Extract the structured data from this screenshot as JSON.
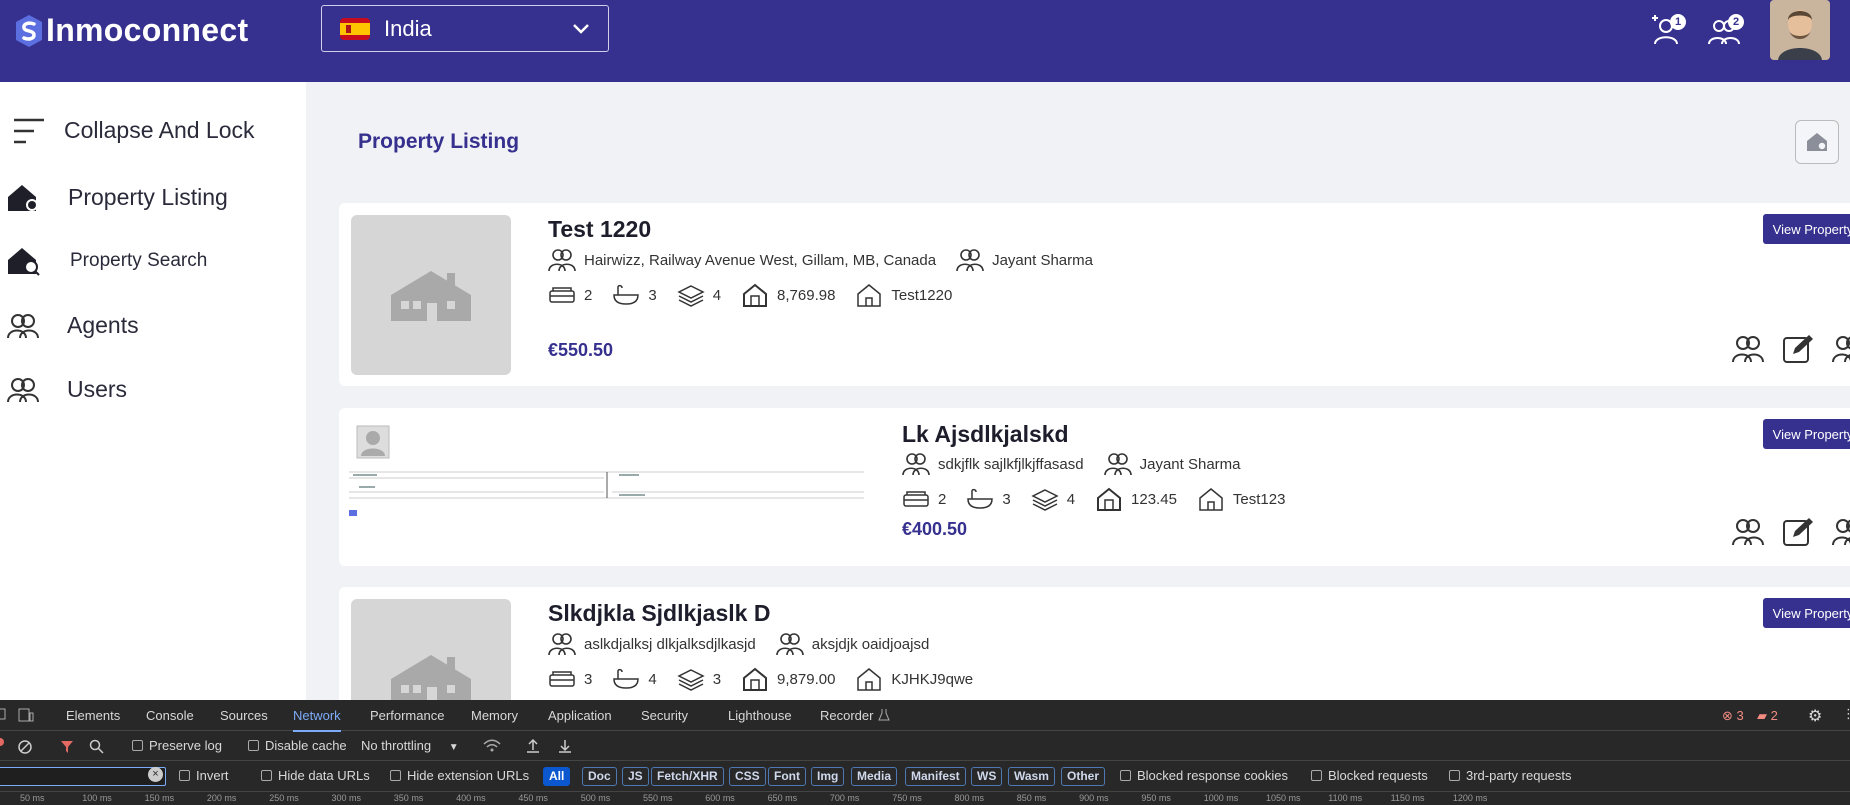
{
  "header": {
    "brand": "Inmoconnect",
    "country": "India",
    "badge_1": "1",
    "badge_2": "2"
  },
  "sidebar": {
    "items": [
      {
        "label": "Collapse And Lock",
        "icon": "menu-icon"
      },
      {
        "label": "Property Listing",
        "icon": "house-gear-icon"
      },
      {
        "label": "Property Search",
        "icon": "house-search-icon"
      },
      {
        "label": "Agents",
        "icon": "users-icon"
      },
      {
        "label": "Users",
        "icon": "users-icon"
      }
    ]
  },
  "main": {
    "title": "Property Listing",
    "view_label": "View Property"
  },
  "properties": [
    {
      "title": "Test 1220",
      "address": "Hairwizz, Railway Avenue West, Gillam, MB, Canada",
      "agent": "Jayant Sharma",
      "beds": "2",
      "baths": "3",
      "floors": "4",
      "area": "8,769.98",
      "ref": "Test1220",
      "price": "€550.50"
    },
    {
      "title": "Lk Ajsdlkjalskd",
      "address": "sdkjflk sajlkfjlkjffasasd",
      "agent": "Jayant Sharma",
      "beds": "2",
      "baths": "3",
      "floors": "4",
      "area": "123.45",
      "ref": "Test123",
      "price": "€400.50"
    },
    {
      "title": "Slkdjkla Sjdlkjaslk D",
      "address": "aslkdjalksj dlkjalksdjlkasjd",
      "agent": "aksjdjk oaidjoajsd",
      "beds": "3",
      "baths": "4",
      "floors": "3",
      "area": "9,879.00",
      "ref": "KJHKJ9qwe",
      "price": ""
    }
  ],
  "devtools": {
    "tabs": [
      "Elements",
      "Console",
      "Sources",
      "Network",
      "Performance",
      "Memory",
      "Application",
      "Security",
      "Lighthouse",
      "Recorder"
    ],
    "active_tab": "Network",
    "errors": "3",
    "issues": "2",
    "preserve_log": "Preserve log",
    "disable_cache": "Disable cache",
    "throttling": "No throttling",
    "invert": "Invert",
    "hide_data_urls": "Hide data URLs",
    "hide_ext_urls": "Hide extension URLs",
    "filters": [
      "All",
      "Doc",
      "JS",
      "Fetch/XHR",
      "CSS",
      "Font",
      "Img",
      "Media",
      "Manifest",
      "WS",
      "Wasm",
      "Other"
    ],
    "blocked_cookies": "Blocked response cookies",
    "blocked_requests": "Blocked requests",
    "third_party": "3rd-party requests",
    "timeline": [
      "50 ms",
      "100 ms",
      "150 ms",
      "200 ms",
      "250 ms",
      "300 ms",
      "350 ms",
      "400 ms",
      "450 ms",
      "500 ms",
      "550 ms",
      "600 ms",
      "650 ms",
      "700 ms",
      "750 ms",
      "800 ms",
      "850 ms",
      "900 ms",
      "950 ms",
      "1000 ms",
      "1050 ms",
      "1100 ms",
      "1150 ms",
      "1200 ms"
    ]
  }
}
